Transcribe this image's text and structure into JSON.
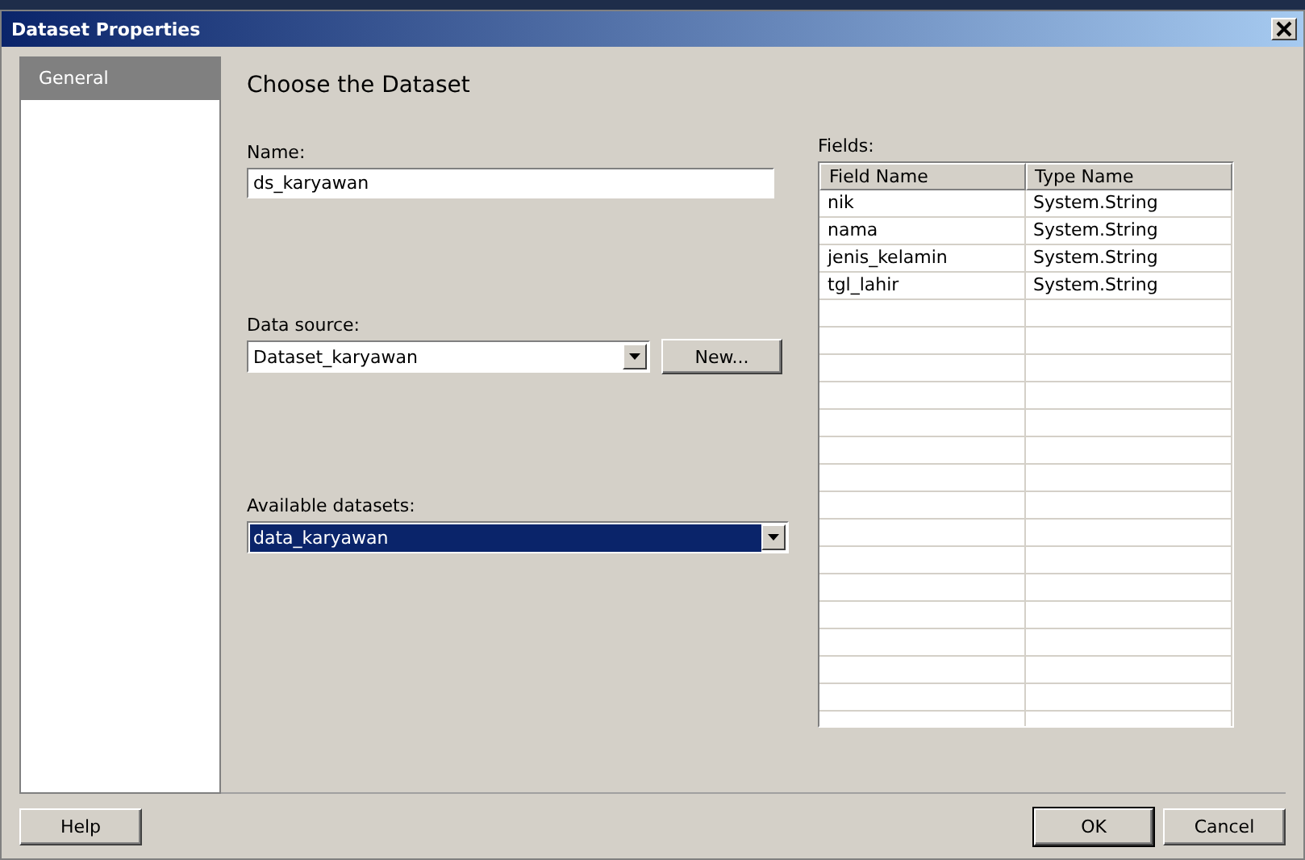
{
  "window": {
    "title": "Dataset Properties"
  },
  "sidebar": {
    "items": [
      {
        "label": "General",
        "selected": true
      }
    ]
  },
  "heading": "Choose the Dataset",
  "name_field": {
    "label": "Name:",
    "value": "ds_karyawan"
  },
  "data_source": {
    "label": "Data source:",
    "value": "Dataset_karyawan",
    "new_button": "New..."
  },
  "available_datasets": {
    "label": "Available datasets:",
    "value": "data_karyawan",
    "focused": true
  },
  "fields": {
    "label": "Fields:",
    "columns": [
      "Field Name",
      "Type Name"
    ],
    "rows": [
      [
        "nik",
        "System.String"
      ],
      [
        "nama",
        "System.String"
      ],
      [
        "jenis_kelamin",
        "System.String"
      ],
      [
        "tgl_lahir",
        "System.String"
      ]
    ]
  },
  "buttons": {
    "help": "Help",
    "ok": "OK",
    "cancel": "Cancel"
  }
}
